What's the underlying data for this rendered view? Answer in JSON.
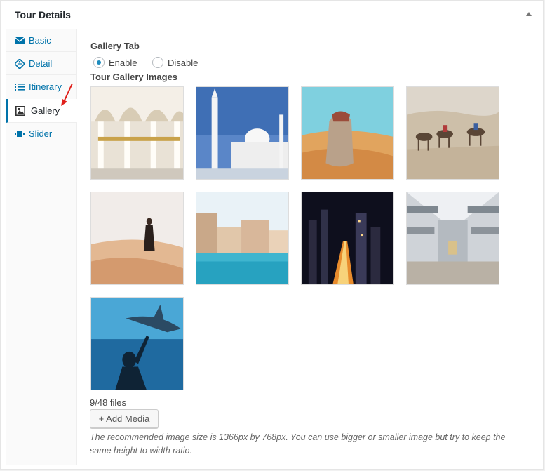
{
  "panel": {
    "title": "Tour Details"
  },
  "sidebar": {
    "tabs": [
      {
        "label": "Basic",
        "icon": "envelope-icon"
      },
      {
        "label": "Detail",
        "icon": "tag-icon"
      },
      {
        "label": "Itinerary",
        "icon": "list-icon"
      },
      {
        "label": "Gallery",
        "icon": "gallery-icon",
        "active": true
      },
      {
        "label": "Slider",
        "icon": "slider-icon"
      }
    ]
  },
  "gallery": {
    "tab_label": "Gallery Tab",
    "enable_label": "Enable",
    "disable_label": "Disable",
    "selected": "Enable",
    "images_label": "Tour Gallery Images",
    "images": [
      {
        "subject": "mosque-arches"
      },
      {
        "subject": "white-mosque"
      },
      {
        "subject": "desert-woman"
      },
      {
        "subject": "camel-caravan"
      },
      {
        "subject": "walking-dunes"
      },
      {
        "subject": "pool-buildings"
      },
      {
        "subject": "night-city"
      },
      {
        "subject": "shopping-mall"
      },
      {
        "subject": "aquarium-shark"
      }
    ],
    "file_count": "9/48 files",
    "add_button": "+ Add Media",
    "note": "The recommended image size is 1366px by 768px. You can use bigger or smaller image but try to keep the same height to width ratio."
  },
  "colors": {
    "link": "#0073aa",
    "arrow": "#e0201b",
    "radio": "#1e8cbe"
  }
}
